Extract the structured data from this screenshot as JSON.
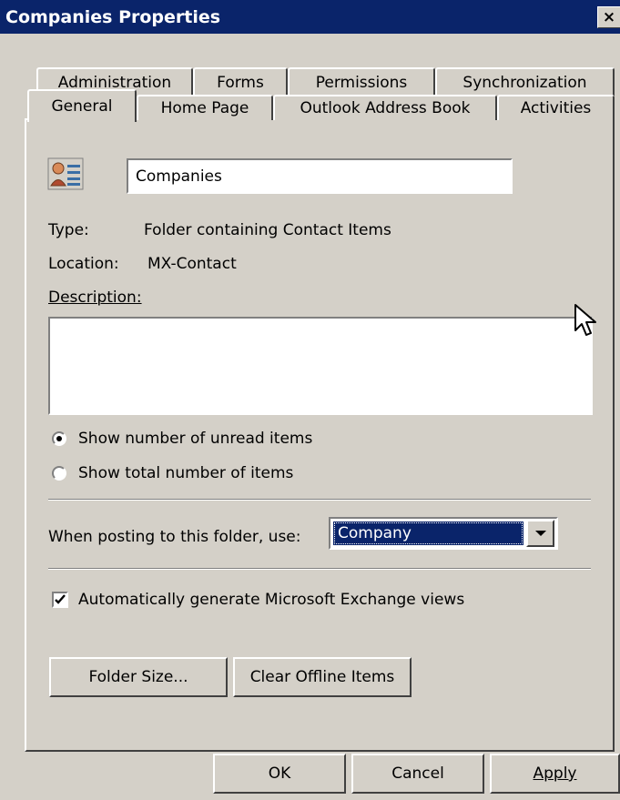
{
  "window": {
    "title": "Companies Properties",
    "close_label": "×"
  },
  "tabs_back": [
    "Administration",
    "Forms",
    "Permissions",
    "Synchronization"
  ],
  "tabs_front": [
    "General",
    "Home Page",
    "Outlook Address Book",
    "Activities"
  ],
  "active_tab": "General",
  "general": {
    "folder_name": "Companies",
    "type_label": "Type:",
    "type_value": "Folder containing Contact Items",
    "location_label": "Location:",
    "location_value": "MX-Contact",
    "description_label": "Description:",
    "description_value": "",
    "radio_unread_label": "Show number of unread items",
    "radio_total_label": "Show total number of items",
    "radio_selected": "unread",
    "posting_label": "When posting to this folder, use:",
    "posting_value": "Company",
    "auto_views_label": "Automatically generate Microsoft Exchange views",
    "auto_views_checked": true,
    "folder_size_label": "Folder Size...",
    "clear_offline_label": "Clear Offline Items"
  },
  "footer": {
    "ok": "OK",
    "cancel": "Cancel",
    "apply": "Apply"
  },
  "icons": {
    "folder": "contact-card-icon",
    "dropdown": "chevron-down-icon",
    "check": "checkmark-icon",
    "cursor": "mouse-pointer-icon"
  },
  "colors": {
    "title_bar": "#0a246a",
    "dialog_bg": "#d4d0c8",
    "selection": "#0a246a"
  }
}
